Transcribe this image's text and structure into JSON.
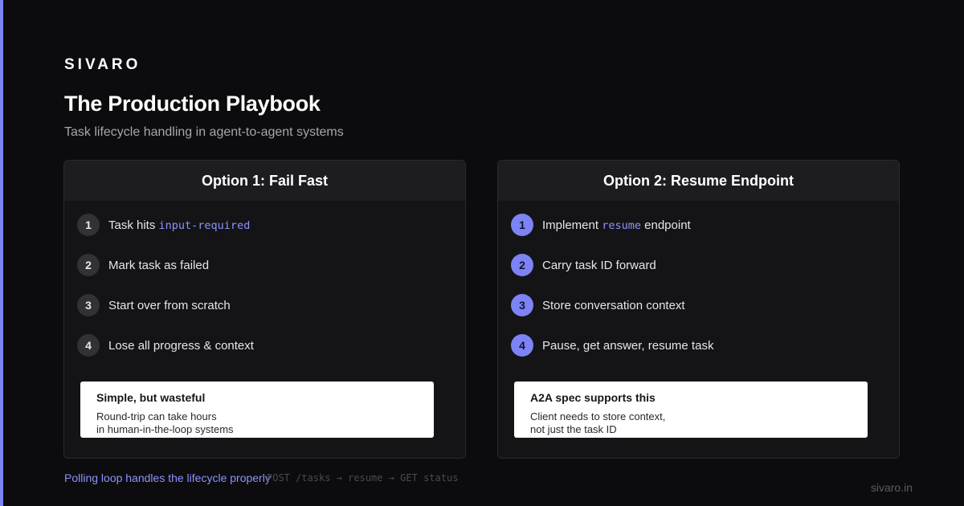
{
  "brand": "SIVARO",
  "title": "The Production Playbook",
  "subtitle": "Task lifecycle handling in agent-to-agent systems",
  "colors": {
    "accent": "#7c83f5",
    "background": "#0c0c0e",
    "card": "#141416",
    "card_header": "#1d1d20",
    "note_bg": "#ffffff"
  },
  "options": [
    {
      "header": "Option 1: Fail Fast",
      "steps": [
        {
          "num": "1",
          "text_before": "Task hits ",
          "code": "input-required",
          "text_after": ""
        },
        {
          "num": "2",
          "text_before": "Mark task as failed",
          "code": "",
          "text_after": ""
        },
        {
          "num": "3",
          "text_before": "Start over from scratch",
          "code": "",
          "text_after": ""
        },
        {
          "num": "4",
          "text_before": "Lose all progress & context",
          "code": "",
          "text_after": ""
        }
      ],
      "note": {
        "title": "Simple, but wasteful",
        "line1": "Round-trip can take hours",
        "line2": "in human-in-the-loop systems"
      }
    },
    {
      "header": "Option 2: Resume Endpoint",
      "steps": [
        {
          "num": "1",
          "text_before": "Implement ",
          "code": "resume",
          "text_after": " endpoint"
        },
        {
          "num": "2",
          "text_before": "Carry task ID forward",
          "code": "",
          "text_after": ""
        },
        {
          "num": "3",
          "text_before": "Store conversation context",
          "code": "",
          "text_after": ""
        },
        {
          "num": "4",
          "text_before": "Pause, get answer, resume task",
          "code": "",
          "text_after": ""
        }
      ],
      "note": {
        "title": "A2A spec supports this",
        "line1": "Client needs to store context,",
        "line2": "not just the task ID"
      }
    }
  ],
  "footer": {
    "link": "Polling loop handles the lifecycle properly",
    "code": "POST /tasks → resume → GET status",
    "site": "sivaro.in"
  }
}
